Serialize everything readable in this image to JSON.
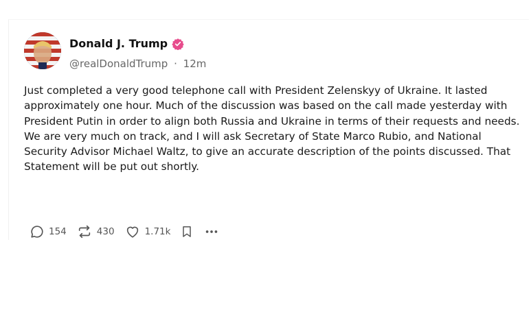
{
  "author": {
    "display_name": "Donald J. Trump",
    "handle": "@realDonaldTrump",
    "separator": "·",
    "time_ago": "12m"
  },
  "post": {
    "text": "Just completed a very good telephone call with President Zelenskyy of Ukraine. It lasted approximately one hour. Much of the discussion was based on the call made yesterday with President Putin in order to align both Russia and Ukraine in terms of their requests and needs. We are very much on track, and I will ask Secretary of State Marco Rubio, and National Security Advisor Michael Waltz, to give an accurate description of the points discussed. That Statement will be put out shortly."
  },
  "actions": {
    "replies": "154",
    "reposts": "430",
    "likes": "1.71k"
  },
  "colors": {
    "verified_badge": "#e74c8c",
    "muted_text": "#666666",
    "icon": "#555555"
  },
  "icons": {
    "reply": "reply-icon",
    "repost": "repost-icon",
    "like": "heart-icon",
    "bookmark": "bookmark-icon",
    "more": "more-icon",
    "verified": "verified-badge-icon"
  }
}
